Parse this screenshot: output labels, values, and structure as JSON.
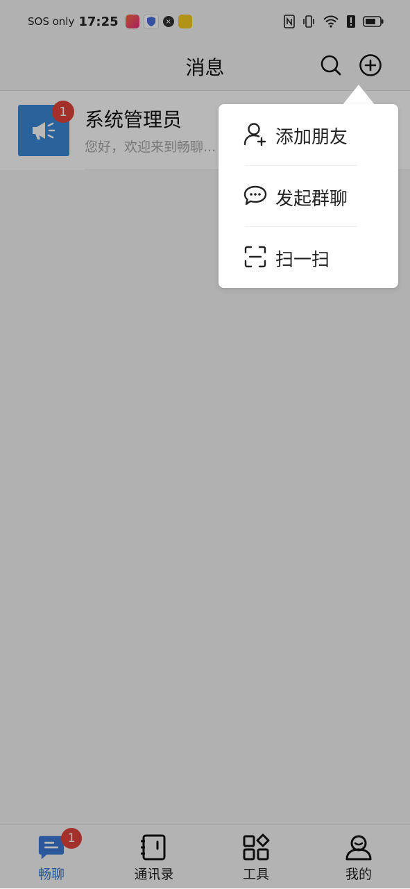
{
  "status_bar": {
    "carrier": "SOS only",
    "time": "17:25",
    "app_icons": [
      "video-app-icon",
      "shield-app-icon",
      "security-app-icon",
      "game-app-icon"
    ],
    "right_icons": [
      "nfc-icon",
      "vibrate-icon",
      "wifi-icon",
      "alert-icon",
      "battery-icon"
    ]
  },
  "header": {
    "title": "消息",
    "search_icon": "search-icon",
    "add_icon": "plus-circle-icon"
  },
  "conversations": [
    {
      "name": "系统管理员",
      "preview": "您好，欢迎来到畅聊...",
      "badge": "1",
      "avatar_icon": "megaphone-icon"
    }
  ],
  "popup_menu": {
    "items": [
      {
        "label": "添加朋友",
        "icon": "add-user-icon"
      },
      {
        "label": "发起群聊",
        "icon": "chat-bubble-icon"
      },
      {
        "label": "扫一扫",
        "icon": "scan-icon"
      }
    ]
  },
  "tabbar": {
    "tabs": [
      {
        "label": "畅聊",
        "icon": "chat-icon",
        "active": true,
        "badge": "1"
      },
      {
        "label": "通讯录",
        "icon": "contacts-book-icon",
        "active": false
      },
      {
        "label": "工具",
        "icon": "tools-grid-icon",
        "active": false
      },
      {
        "label": "我的",
        "icon": "profile-icon",
        "active": false
      }
    ]
  },
  "colors": {
    "accent": "#3b7bd6",
    "badge": "#e2433b",
    "avatar": "#3b8ad9",
    "overlay": "rgba(0,0,0,0.28)"
  }
}
